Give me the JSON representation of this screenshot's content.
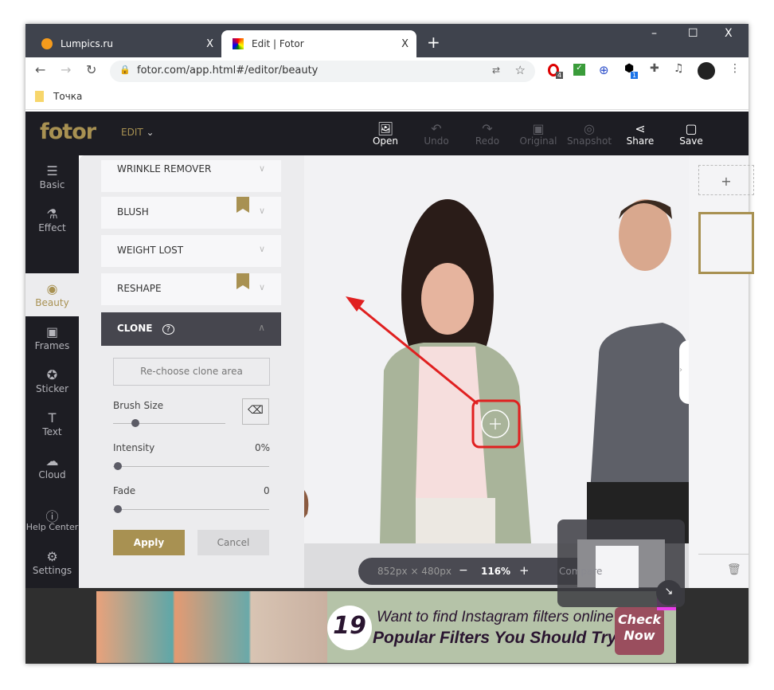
{
  "browser": {
    "tabs": [
      {
        "label": "Lumpics.ru",
        "close": "X"
      },
      {
        "label": "Edit | Fotor",
        "close": "X"
      }
    ],
    "new_tab": "+",
    "window_controls": [
      "–",
      "☐",
      "X"
    ],
    "url": "fotor.com/app.html#/editor/beauty",
    "bookmark": "Точка",
    "ext_badges": [
      "4",
      "1"
    ]
  },
  "app": {
    "logo": "fotor",
    "mode": "EDIT",
    "toolbar": [
      {
        "label": "Open",
        "icon": "image-plus-icon",
        "enabled": true
      },
      {
        "label": "Undo",
        "icon": "undo-icon",
        "enabled": false
      },
      {
        "label": "Redo",
        "icon": "redo-icon",
        "enabled": false
      },
      {
        "label": "Original",
        "icon": "original-icon",
        "enabled": false
      },
      {
        "label": "Snapshot",
        "icon": "snapshot-icon",
        "enabled": false
      },
      {
        "label": "Share",
        "icon": "share-icon",
        "enabled": true
      },
      {
        "label": "Save",
        "icon": "save-icon",
        "enabled": true
      }
    ]
  },
  "nav": [
    {
      "label": "Basic",
      "icon": "sliders-icon"
    },
    {
      "label": "Effect",
      "icon": "flask-icon"
    },
    {
      "label": "Beauty",
      "icon": "eye-icon",
      "active": true
    },
    {
      "label": "Frames",
      "icon": "frame-icon"
    },
    {
      "label": "Sticker",
      "icon": "star-icon"
    },
    {
      "label": "Text",
      "icon": "text-icon"
    },
    {
      "label": "Cloud",
      "icon": "cloud-icon"
    },
    {
      "label": "Help Center",
      "icon": "help-icon"
    },
    {
      "label": "Settings",
      "icon": "gear-icon"
    }
  ],
  "panel": {
    "sections": [
      {
        "label": "WRINKLE REMOVER"
      },
      {
        "label": "BLUSH",
        "premium": true
      },
      {
        "label": "WEIGHT LOST"
      },
      {
        "label": "RESHAPE",
        "premium": true
      }
    ],
    "clone": {
      "title": "CLONE",
      "rechoose": "Re-choose clone area",
      "brush_label": "Brush Size",
      "brush_value": 0.2,
      "intensity_label": "Intensity",
      "intensity_value": "0%",
      "fade_label": "Fade",
      "fade_value": "0",
      "apply": "Apply",
      "cancel": "Cancel"
    }
  },
  "canvas": {
    "dimensions": "852px × 480px",
    "zoom": "116%",
    "zoom_out": "−",
    "zoom_in": "+",
    "compare": "Compare"
  },
  "right_panel": {
    "add": "+"
  },
  "ad": {
    "number": "19",
    "line1": "Want to find Instagram filters online?",
    "line2": "Popular Filters You Should Try",
    "cta": "Check Now",
    "close": "✕"
  },
  "colors": {
    "accent": "#a89152",
    "dark": "#1d1d23",
    "highlight": "#e02020"
  }
}
